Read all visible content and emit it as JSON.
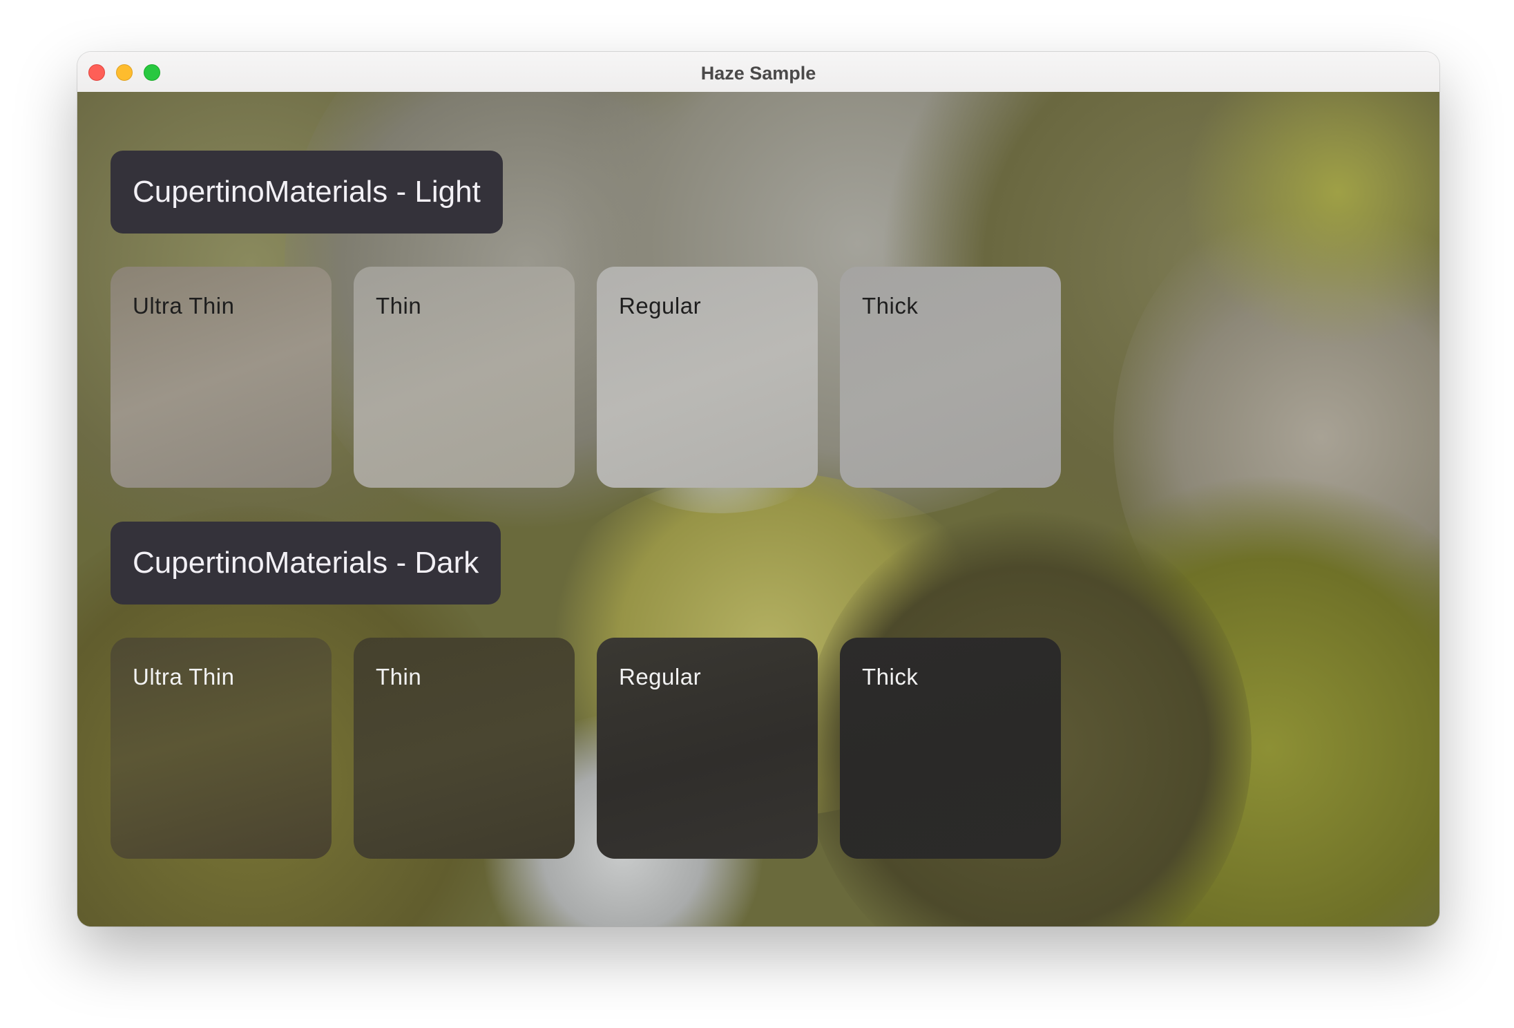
{
  "window": {
    "title": "Haze Sample"
  },
  "sections": [
    {
      "heading": "CupertinoMaterials - Light",
      "tiles": [
        "Ultra Thin",
        "Thin",
        "Regular",
        "Thick"
      ]
    },
    {
      "heading": "CupertinoMaterials - Dark",
      "tiles": [
        "Ultra Thin",
        "Thin",
        "Regular",
        "Thick"
      ]
    }
  ],
  "colors": {
    "header_background": "#34323a",
    "close": "#fe5f57",
    "minimize": "#febc2e",
    "zoom": "#28c840"
  }
}
